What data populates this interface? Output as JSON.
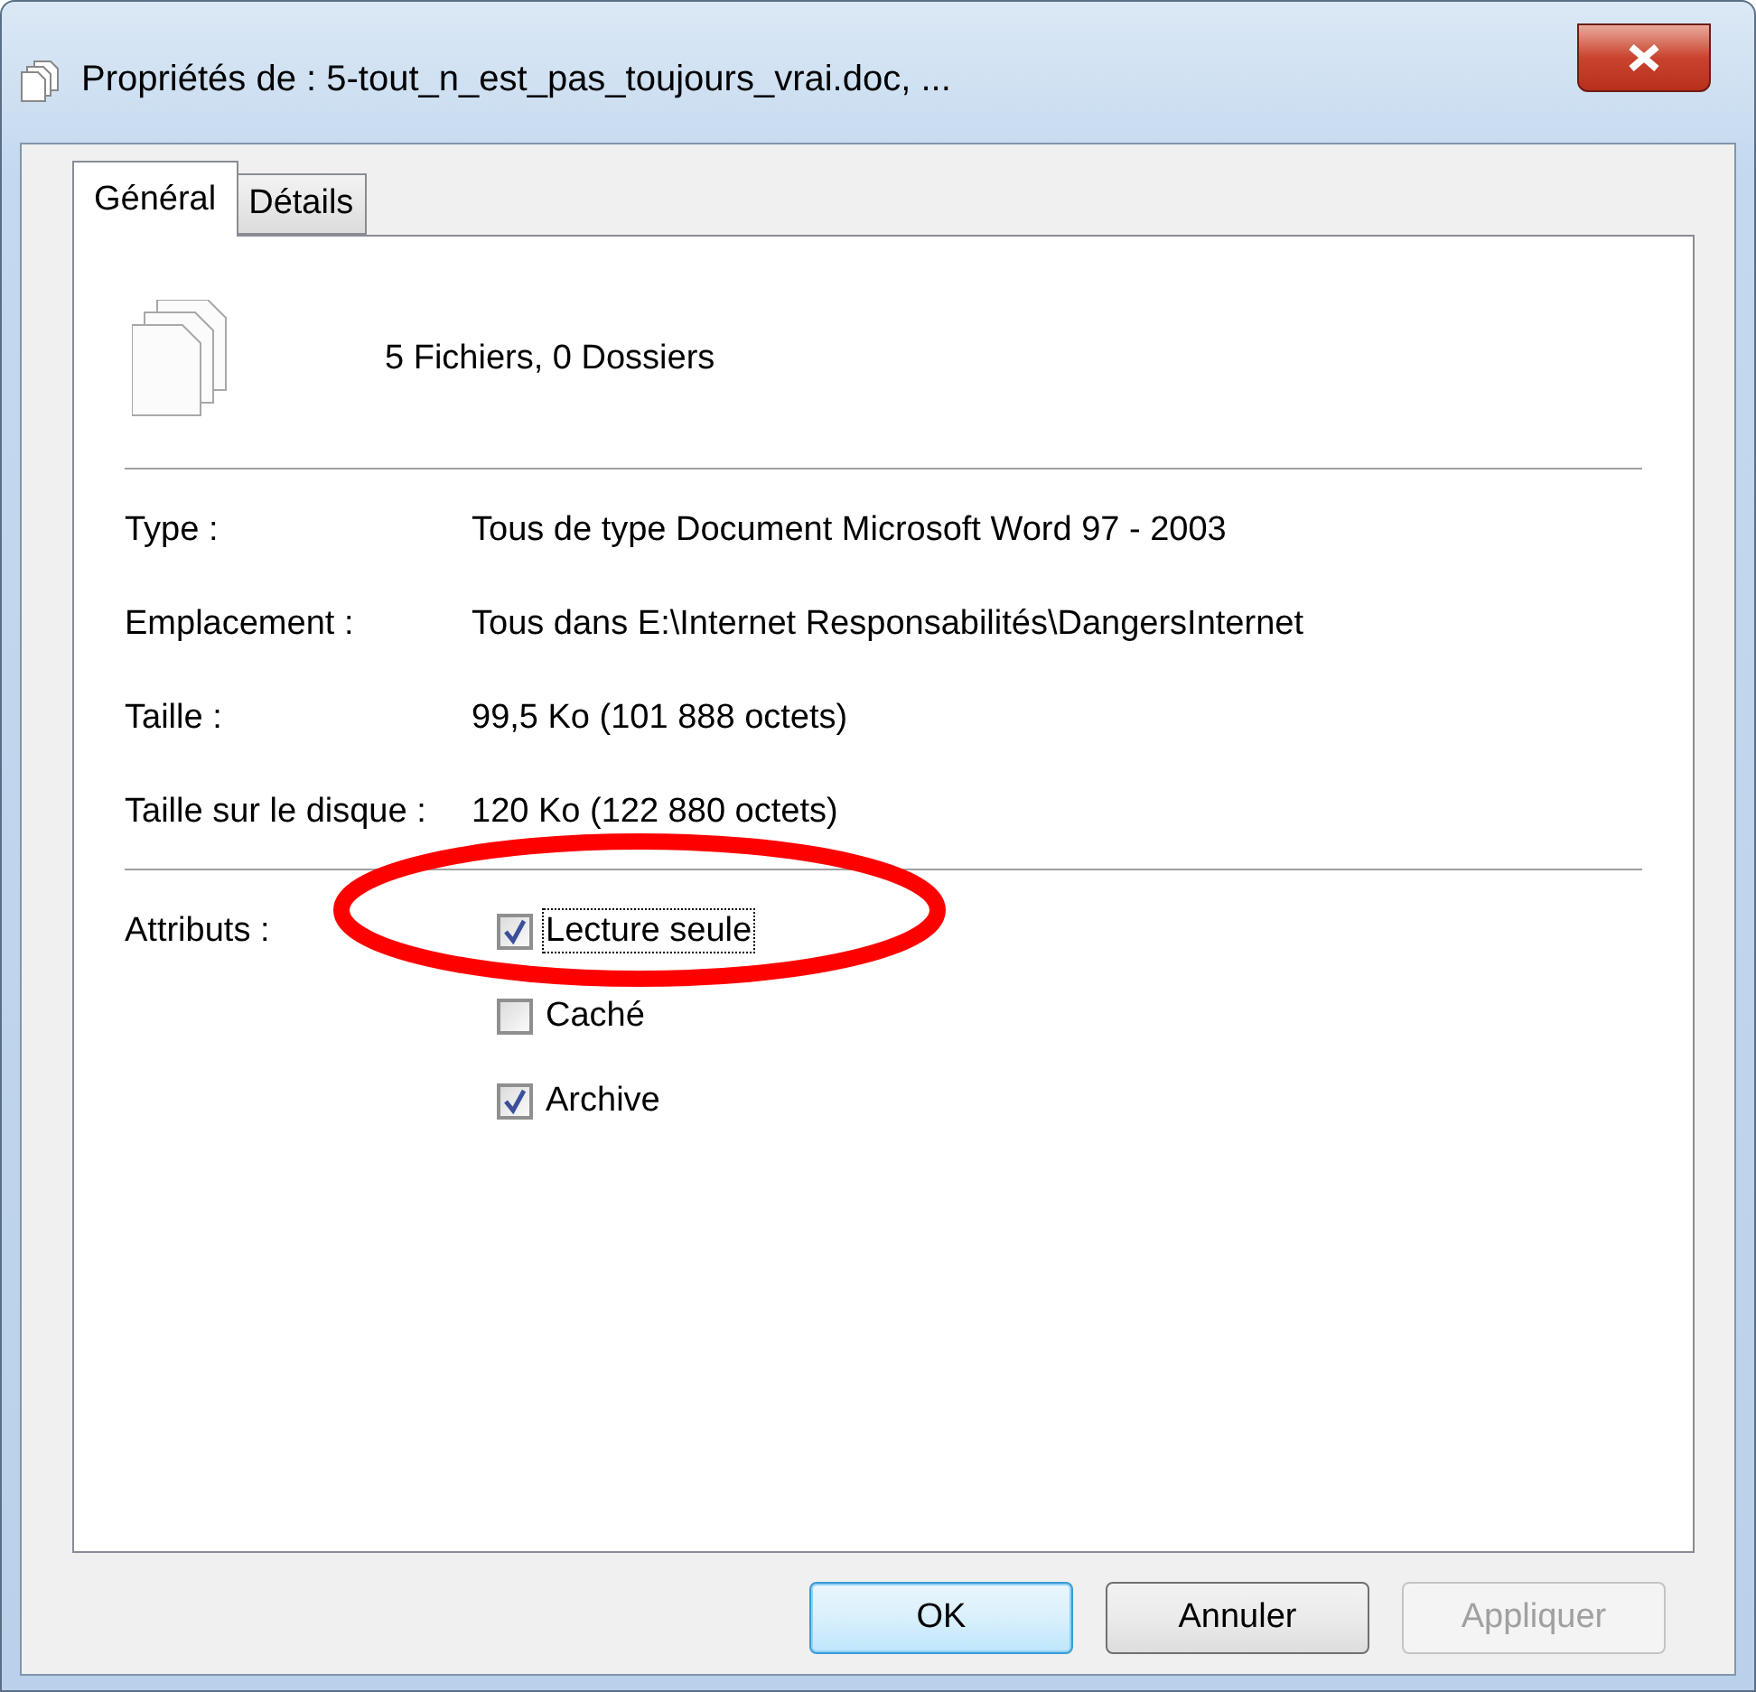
{
  "window": {
    "title": "Propriétés de : 5-tout_n_est_pas_toujours_vrai.doc, ..."
  },
  "tabs": [
    {
      "label": "Général",
      "selected": true
    },
    {
      "label": "Détails",
      "selected": false
    }
  ],
  "summary": "5 Fichiers, 0 Dossiers",
  "properties": [
    {
      "label": "Type :",
      "value": "Tous de type Document Microsoft Word 97 - 2003"
    },
    {
      "label": "Emplacement :",
      "value": "Tous dans E:\\Internet Responsabilités\\DangersInternet"
    },
    {
      "label": "Taille :",
      "value": "99,5 Ko (101 888 octets)"
    },
    {
      "label": "Taille sur le disque :",
      "value": "120 Ko (122 880 octets)"
    }
  ],
  "attributes": {
    "label": "Attributs :",
    "items": [
      {
        "label": "Lecture seule",
        "checked": true,
        "focused": true
      },
      {
        "label": "Caché",
        "checked": false,
        "focused": false
      },
      {
        "label": "Archive",
        "checked": true,
        "focused": false
      }
    ]
  },
  "annotation": {
    "kind": "ellipse",
    "color": "#ff0000"
  },
  "buttons": [
    {
      "label": "OK",
      "default": true,
      "disabled": false
    },
    {
      "label": "Annuler",
      "default": false,
      "disabled": false
    },
    {
      "label": "Appliquer",
      "default": false,
      "disabled": true
    }
  ]
}
